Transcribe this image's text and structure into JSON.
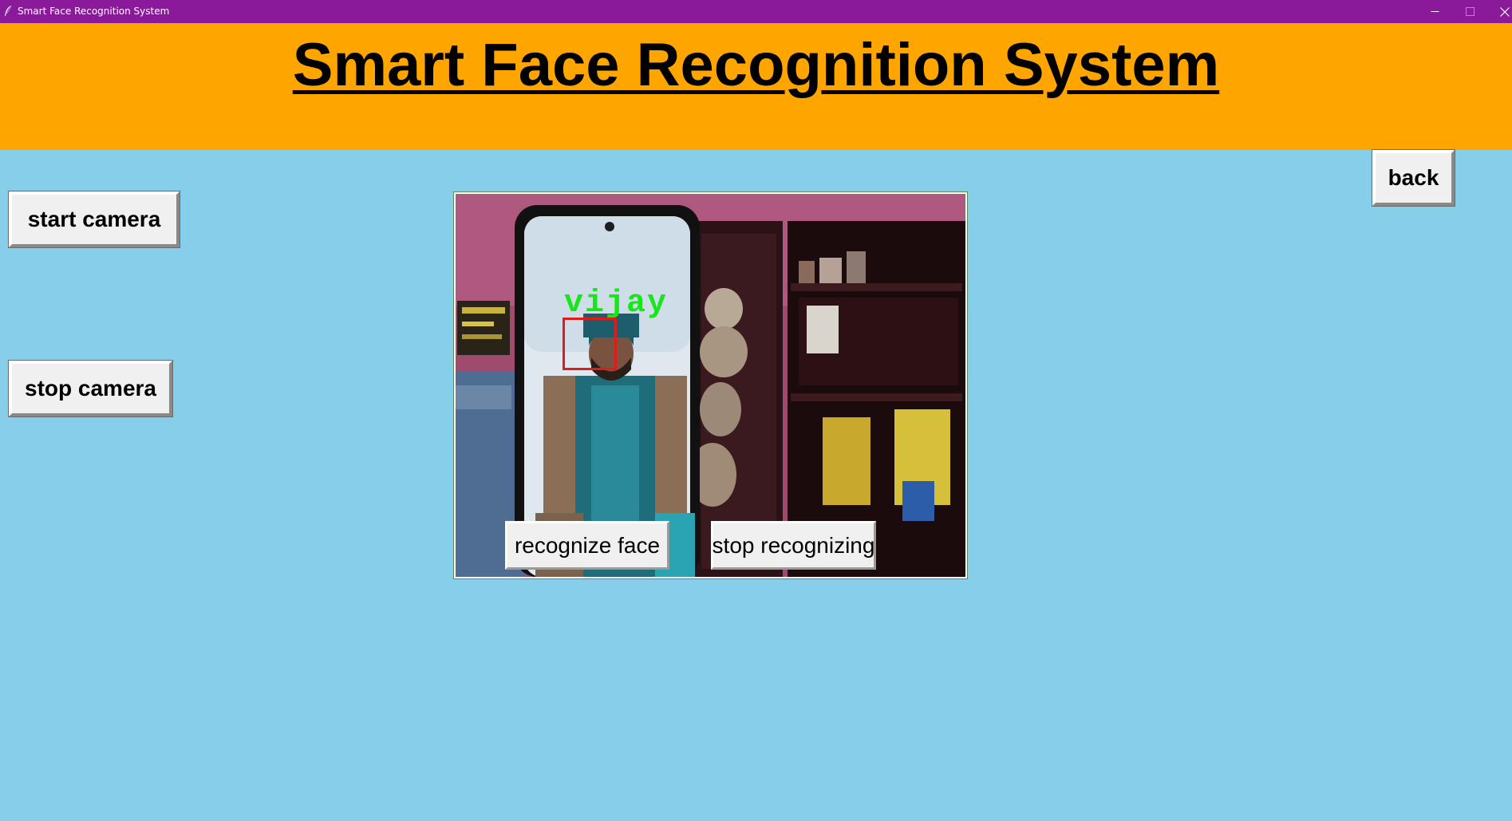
{
  "window": {
    "title": "Smart Face Recognition System",
    "app_icon": "feather-icon",
    "controls": {
      "minimize": "minimize-icon",
      "maximize": "maximize-icon",
      "close": "close-icon"
    },
    "titlebar_color": "#8B1A9A"
  },
  "header": {
    "title": "Smart Face Recognition System",
    "background": "#FFA500"
  },
  "controls": {
    "start_camera_label": "start camera",
    "stop_camera_label": "stop camera",
    "back_label": "back"
  },
  "camera": {
    "detected_name": "vijay",
    "detection_box_color": "#E11A1A",
    "label_color": "#19E619",
    "recognize_label": "recognize face",
    "stop_recognizing_label": "stop recognizing"
  },
  "theme": {
    "page_background": "#87CEEB"
  }
}
